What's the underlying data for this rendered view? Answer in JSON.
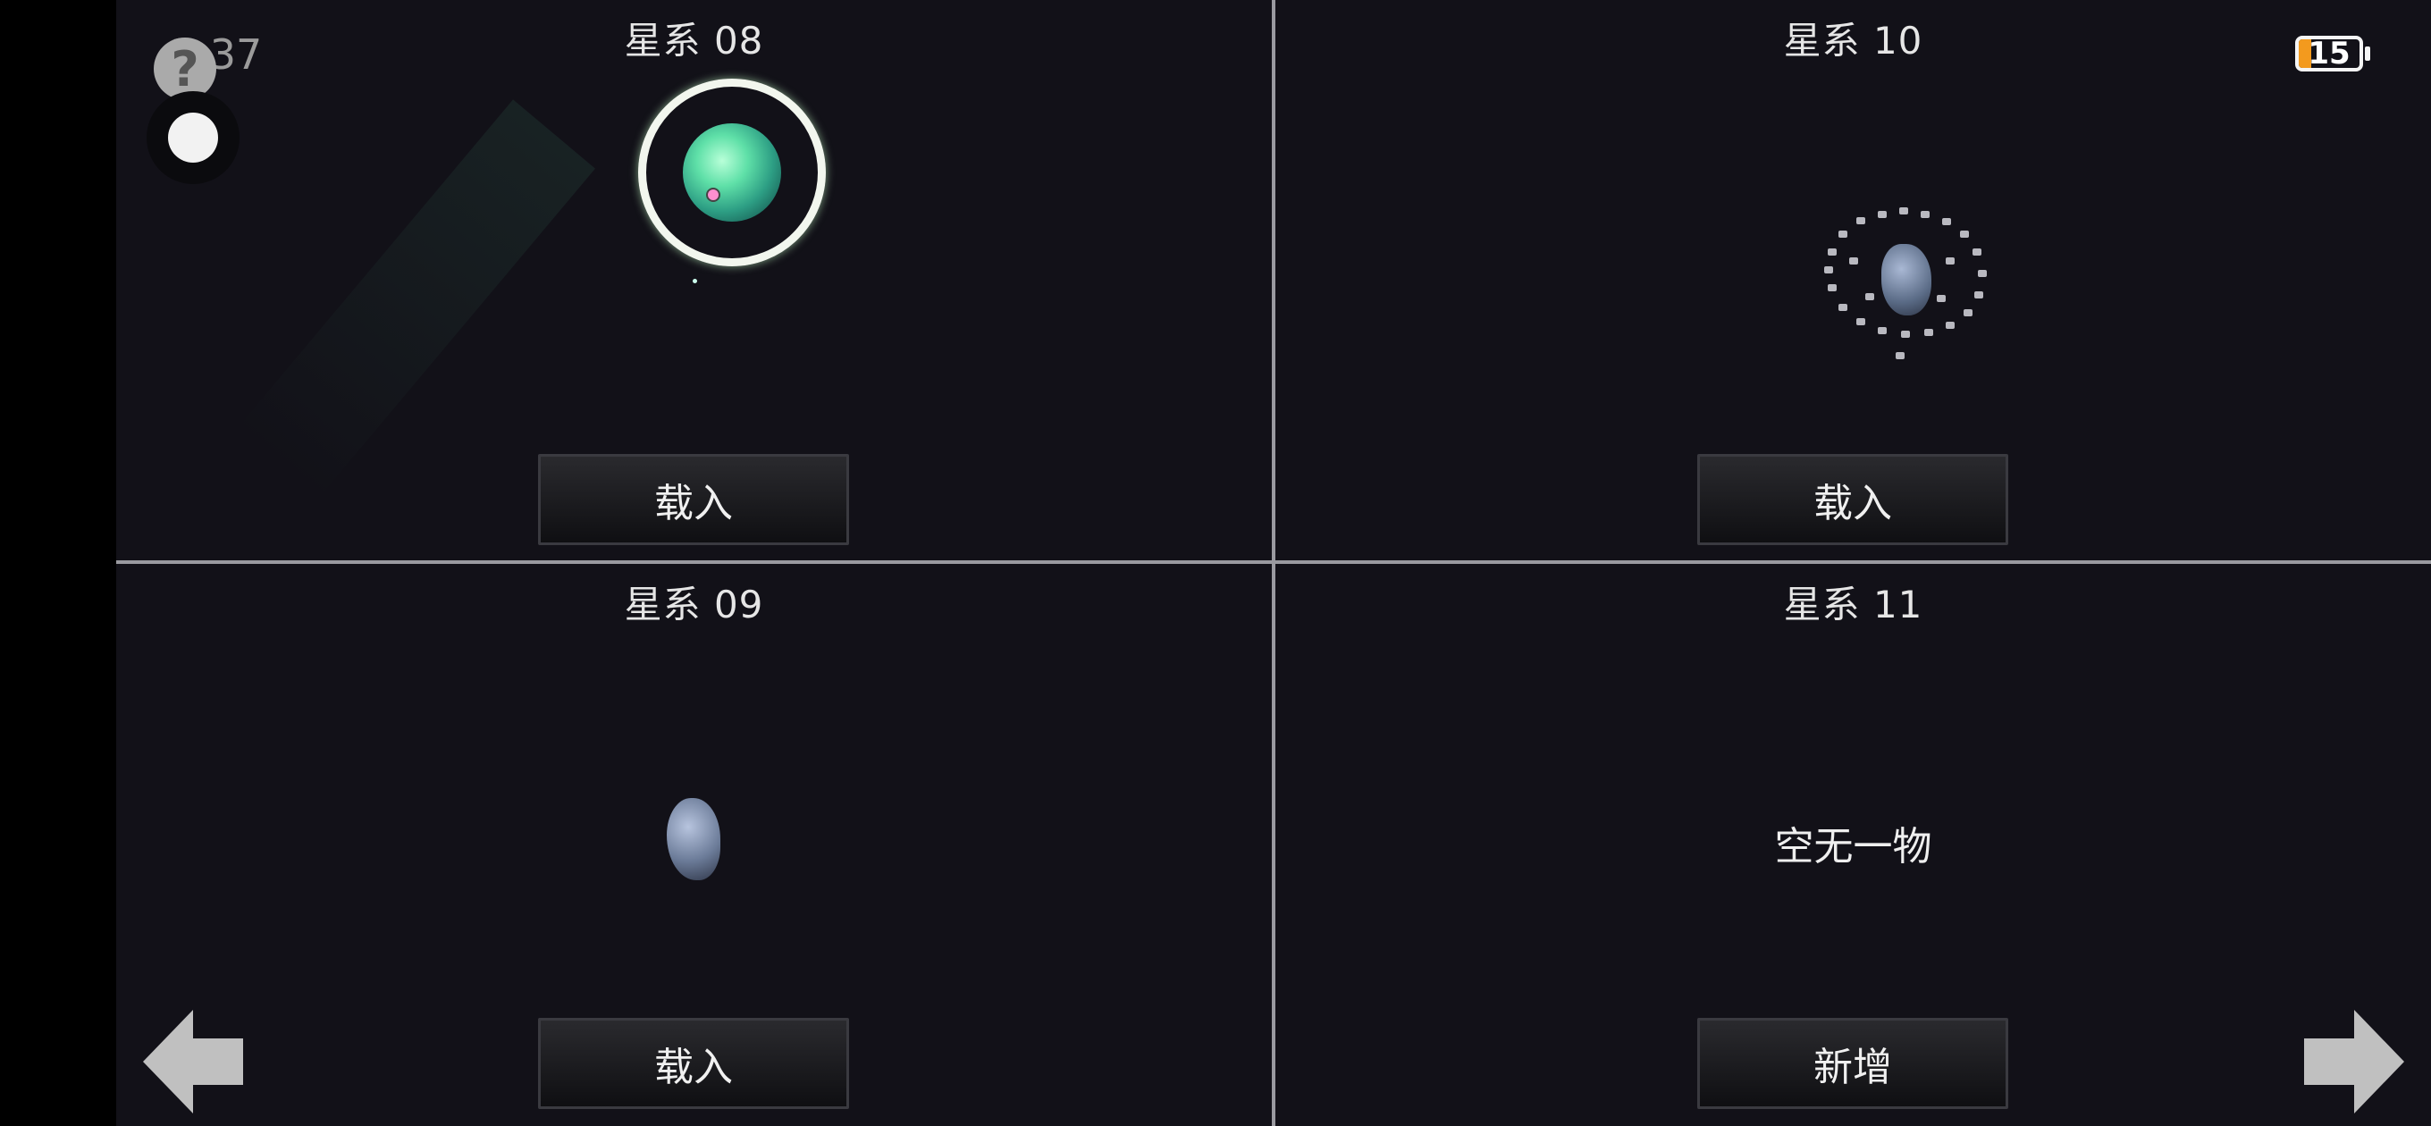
{
  "status": {
    "time": "3:37",
    "battery_level": "15"
  },
  "slots": {
    "s08": {
      "title": "星系 08",
      "button": "载入"
    },
    "s10": {
      "title": "星系 10",
      "button": "载入"
    },
    "s09": {
      "title": "星系 09",
      "button": "载入"
    },
    "s11": {
      "title": "星系 11",
      "empty_text": "空无一物",
      "button": "新增"
    }
  },
  "icons": {
    "help": "question-icon",
    "toggle": "circle-toggle-icon",
    "battery": "battery-icon",
    "prev": "arrow-left-icon",
    "next": "arrow-right-icon"
  },
  "colors": {
    "background": "#121118",
    "divider": "#9a9aa0",
    "battery_low": "#f39a1e"
  }
}
